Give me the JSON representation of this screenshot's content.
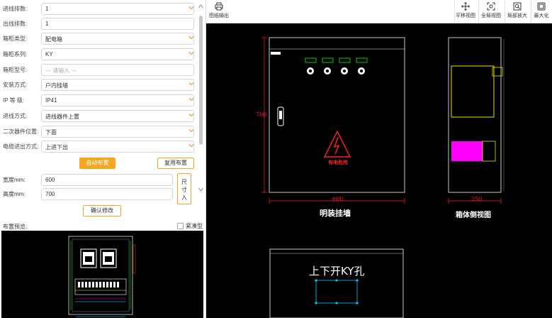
{
  "form": {
    "rows": [
      {
        "label": "进线排数:",
        "value": "1",
        "type": "select"
      },
      {
        "label": "出线排数:",
        "value": "1",
        "type": "input"
      },
      {
        "label": "箱柜类型:",
        "value": "配电箱",
        "type": "select"
      },
      {
        "label": "箱柜系列:",
        "value": "KY",
        "type": "select"
      },
      {
        "label": "箱柜型号:",
        "placeholder": "--- 请输入 ---",
        "type": "input"
      },
      {
        "label": "安装方式:",
        "value": "户内挂墙",
        "type": "select"
      },
      {
        "label": "IP 等 级:",
        "value": "IP41",
        "type": "select"
      },
      {
        "label": "进线方式:",
        "value": "进线器件上置",
        "type": "select"
      },
      {
        "label": "二次器件位置:",
        "value": "下面",
        "type": "select"
      },
      {
        "label": "电缆进出方式:",
        "value": "上进下出",
        "type": "select"
      }
    ],
    "auto_layout_label": "自动布置",
    "reuse_layout_label": "复用布置",
    "width_label": "宽度mm:",
    "width_value": "600",
    "height_label": "高度mm:",
    "height_value": "700",
    "size_btn_label": "尺寸入",
    "confirm_label": "确认修改",
    "preview_label": "布置预览:",
    "compact_label": "紧凑型"
  },
  "toolbar": {
    "export_label": "图纸输出",
    "pan_label": "平移视图",
    "global_label": "全局视图",
    "zoom_label": "局部放大",
    "max_label": "最大化"
  },
  "drawing": {
    "front_height_dim": "700",
    "front_width_dim": "600",
    "side_depth_dim": "250",
    "front_caption": "明装挂墙",
    "side_caption": "箱体侧视图",
    "top_caption": "上下开KY孔",
    "warning_text": "有电危险"
  },
  "colors": {
    "accent": "#f5a623",
    "canvas": "#000000",
    "cad_red": "#ff2020",
    "cad_yellow": "#e6e600",
    "cad_magenta": "#ff00ff",
    "cad_cyan": "#00c8ff"
  }
}
